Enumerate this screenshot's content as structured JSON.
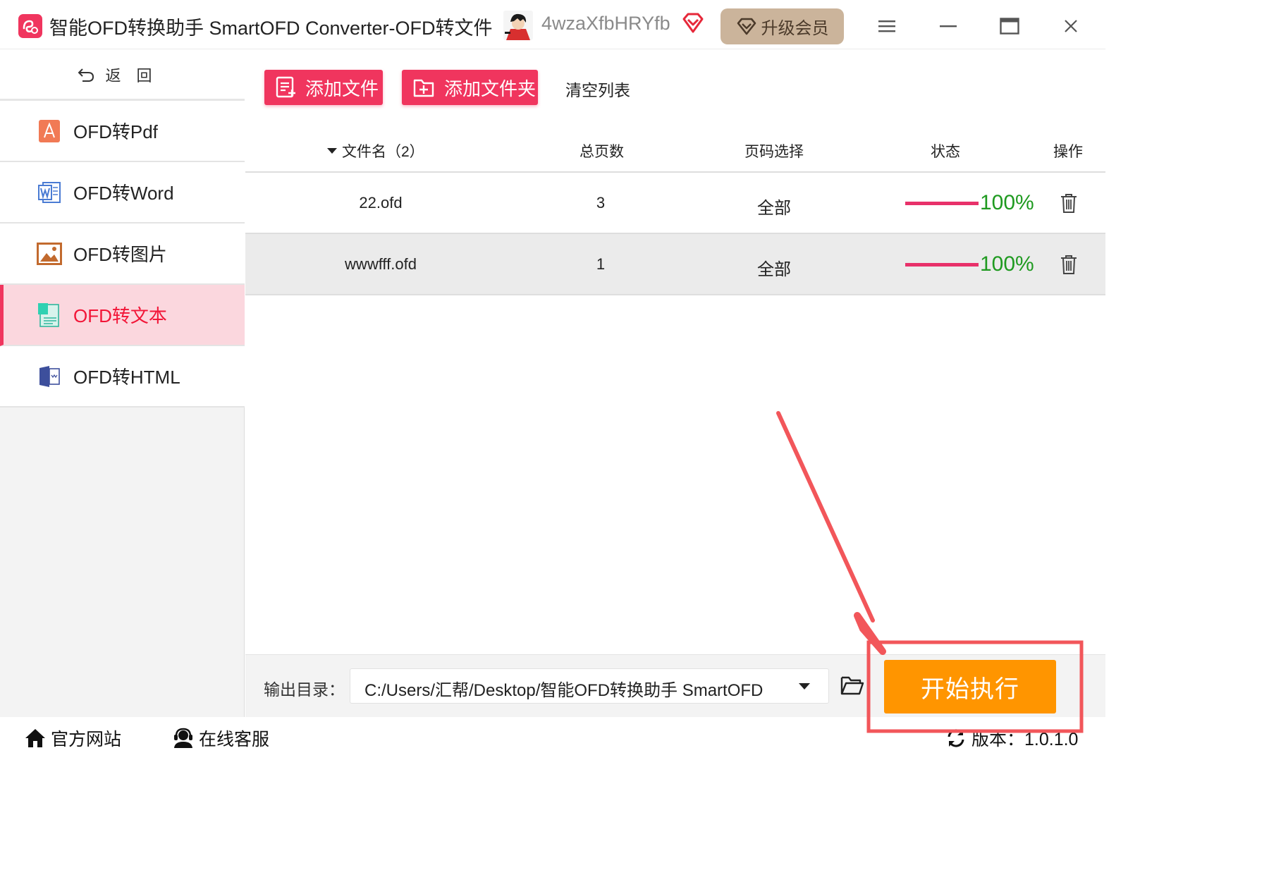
{
  "window": {
    "title": "智能OFD转换助手 SmartOFD Converter-OFD转文件",
    "username": "4wzaXfbHRYfb",
    "upgrade_label": "升级会员"
  },
  "sidebar": {
    "back_label": "返回",
    "items": [
      {
        "label": "OFD转Pdf",
        "icon": "pdf-icon",
        "active": false
      },
      {
        "label": "OFD转Word",
        "icon": "word-icon",
        "active": false
      },
      {
        "label": "OFD转图片",
        "icon": "image-icon",
        "active": false
      },
      {
        "label": "OFD转文本",
        "icon": "text-doc-icon",
        "active": true
      },
      {
        "label": "OFD转HTML",
        "icon": "html-icon",
        "active": false
      }
    ]
  },
  "toolbar": {
    "add_file": "添加文件",
    "add_folder": "添加文件夹",
    "clear_list": "清空列表"
  },
  "table": {
    "headers": {
      "filename": "文件名（2）",
      "pages": "总页数",
      "page_select": "页码选择",
      "status": "状态",
      "actions": "操作"
    },
    "rows": [
      {
        "filename": "22.ofd",
        "pages": "3",
        "page_select": "全部",
        "progress": 1.0,
        "status": "100%"
      },
      {
        "filename": "wwwfff.ofd",
        "pages": "1",
        "page_select": "全部",
        "progress": 1.0,
        "status": "100%"
      }
    ]
  },
  "output": {
    "label": "输出目录：",
    "path": "C:/Users/汇帮/Desktop/智能OFD转换助手 SmartOFD",
    "start_label": "开始执行"
  },
  "statusbar": {
    "website": "官方网站",
    "support": "在线客服",
    "version": "版本：1.0.1.0"
  },
  "colors": {
    "accent": "#f0355e",
    "active_bg": "#fbd7de",
    "start": "#ff9500",
    "progress": "#e8316a",
    "success_text": "#1f9a20",
    "annotation": "#f2565a"
  }
}
